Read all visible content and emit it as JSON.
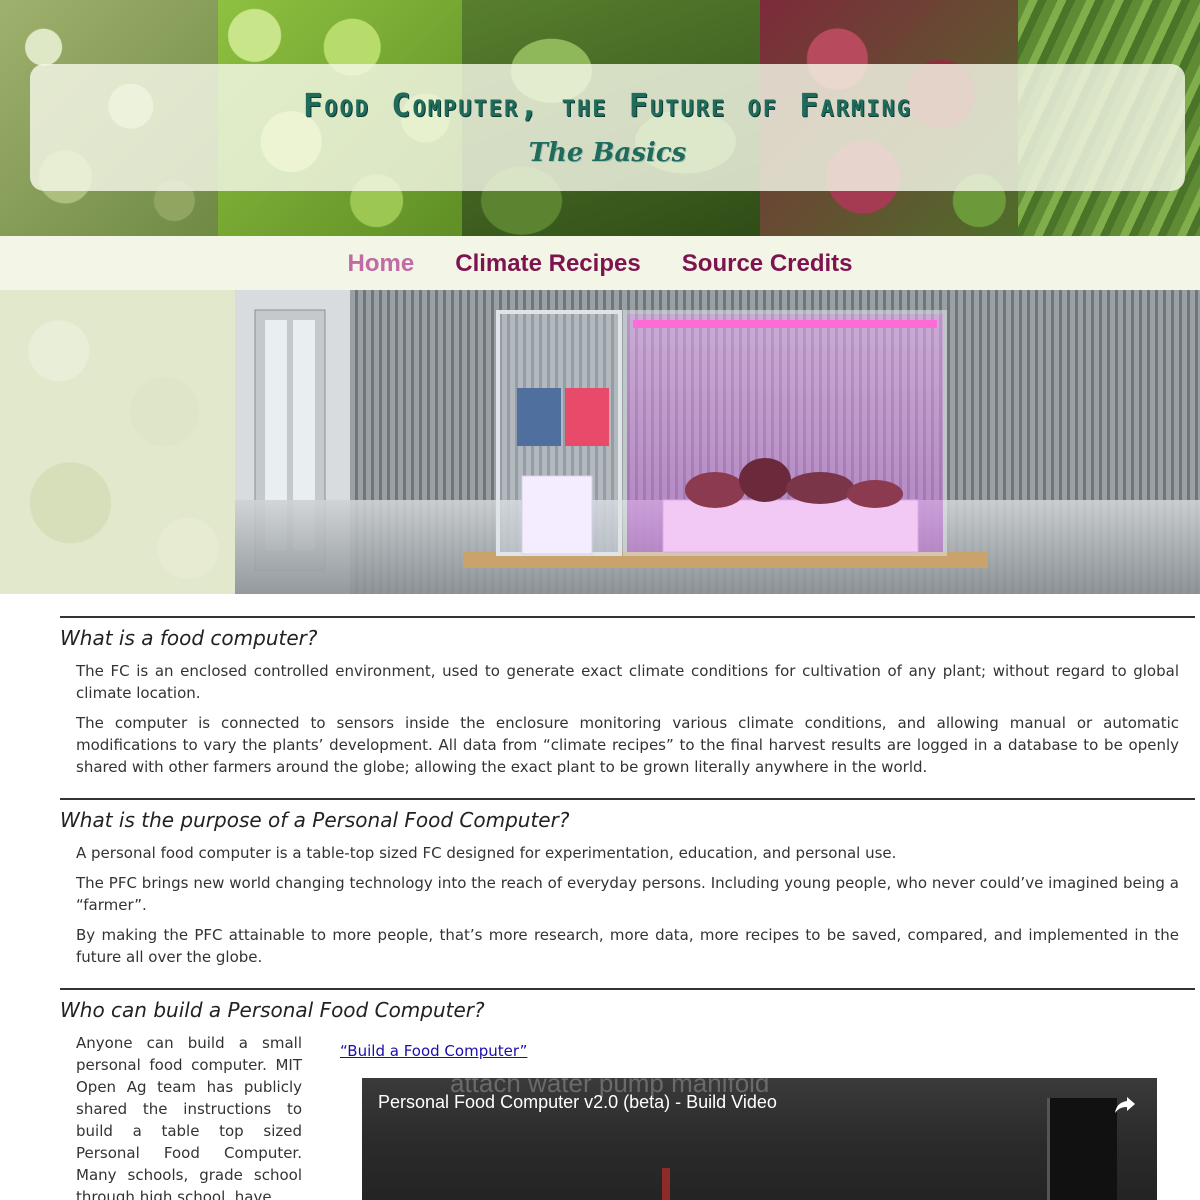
{
  "header": {
    "title": "Food Computer, the Future of Farming",
    "subtitle": "The Basics"
  },
  "nav": {
    "items": [
      {
        "label": "Home",
        "active": true
      },
      {
        "label": "Climate Recipes",
        "active": false
      },
      {
        "label": "Source Credits",
        "active": false
      }
    ]
  },
  "sections": {
    "what": {
      "heading": "What is a food computer?",
      "paragraphs": [
        "The FC is an enclosed controlled environment, used to generate exact climate conditions for cultivation of any plant; without regard to global climate location.",
        "The computer is connected to sensors inside the enclosure monitoring various climate conditions, and allowing manual or automatic modifications to vary the plants’ development. All data from “climate recipes” to the final harvest results are logged in a database to be openly shared with other farmers around the globe; allowing the exact plant to be grown literally anywhere in the world."
      ]
    },
    "purpose": {
      "heading": "What is the purpose of a Personal Food Computer?",
      "paragraphs": [
        "A personal food computer is a table-top sized FC designed for experimentation, education, and personal use.",
        "The PFC brings new world changing technology into the reach of everyday persons. Including young people, who never could’ve imagined being a “farmer”.",
        "By making the PFC attainable to more people, that’s more research, more data, more recipes to be saved, compared, and implemented in the future all over the globe."
      ]
    },
    "who": {
      "heading": "Who can build a Personal Food Computer?",
      "paragraph": "Anyone can build a small personal food computer. MIT Open Ag team has publicly shared the instructions to build a table top sized Personal Food Computer. Many schools, grade school through high school, have",
      "link_label": "“Build a Food Computer”",
      "video": {
        "title": "Personal Food Computer v2.0 (beta) - Build Video",
        "overlay_text": "attach water pump manifold",
        "share_icon": "share-icon"
      }
    }
  },
  "colors": {
    "title": "#1f6b5c",
    "nav": "#7e1350",
    "nav_active": "#c16aa6",
    "link": "#1a0dab"
  }
}
